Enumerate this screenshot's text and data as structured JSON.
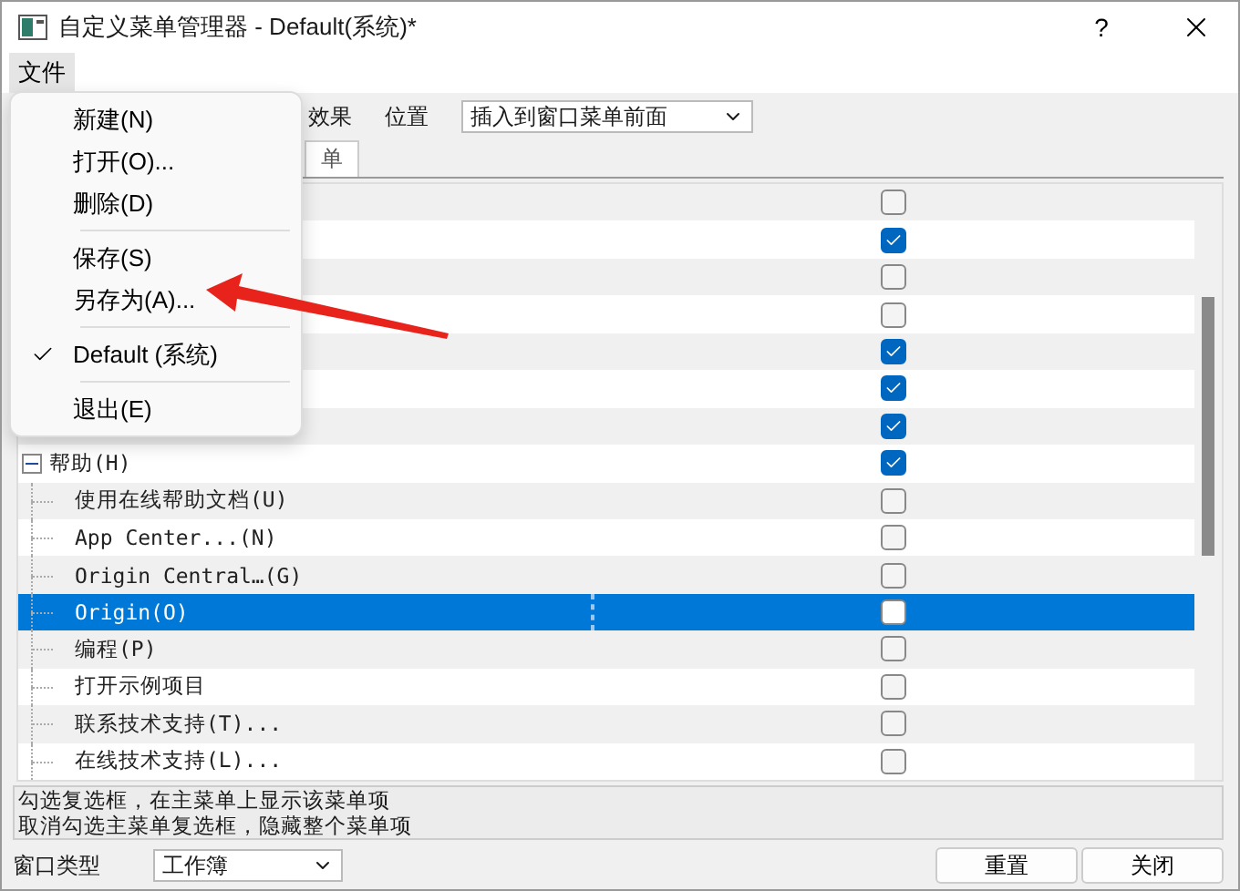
{
  "window": {
    "title": "自定义菜单管理器 - Default(系统)*",
    "help": "?"
  },
  "menubar": [
    {
      "label": "文件",
      "selected": true
    }
  ],
  "file_menu": [
    {
      "kind": "item",
      "label": "新建(N)",
      "checked": false
    },
    {
      "kind": "item",
      "label": "打开(O)...",
      "checked": false
    },
    {
      "kind": "item",
      "label": "删除(D)",
      "checked": false
    },
    {
      "kind": "separator"
    },
    {
      "kind": "item",
      "label": "保存(S)",
      "checked": false
    },
    {
      "kind": "item",
      "label": "另存为(A)...",
      "checked": false
    },
    {
      "kind": "separator"
    },
    {
      "kind": "item",
      "label": "Default (系统)",
      "checked": true
    },
    {
      "kind": "separator"
    },
    {
      "kind": "item",
      "label": "退出(E)",
      "checked": false
    }
  ],
  "toolbar": {
    "effect_label": "效果",
    "position_label": "位置",
    "position_value": "插入到窗口菜单前面"
  },
  "tabs": [
    {
      "label": "单",
      "selected": true
    }
  ],
  "tree": [
    {
      "checked": false
    },
    {
      "checked": true
    },
    {
      "checked": false
    },
    {
      "checked": false
    },
    {
      "checked": true
    },
    {
      "checked": true
    },
    {
      "checked": true
    },
    {
      "label": "帮助(H)",
      "expanded": true,
      "checked": true,
      "children": [
        {
          "label": "使用在线帮助文档(U)",
          "checked": false,
          "selected": false
        },
        {
          "label": "App Center...(N)",
          "checked": false,
          "selected": false
        },
        {
          "label": "Origin Central…(G)",
          "checked": false,
          "selected": false
        },
        {
          "label": "Origin(O)",
          "checked": false,
          "selected": true
        },
        {
          "label": "编程(P)",
          "checked": false,
          "selected": false
        },
        {
          "label": "打开示例项目",
          "checked": false,
          "selected": false
        },
        {
          "label": "联系技术支持(T)...",
          "checked": false,
          "selected": false
        },
        {
          "label": "在线技术支持(L)...",
          "checked": false,
          "selected": false
        }
      ]
    }
  ],
  "hint": [
    "勾选复选框，在主菜单上显示该菜单项",
    "取消勾选主菜单复选框，隐藏整个菜单项"
  ],
  "window_type": {
    "label": "窗口类型",
    "value": "工作簿"
  },
  "buttons": [
    "重置",
    "关闭"
  ]
}
